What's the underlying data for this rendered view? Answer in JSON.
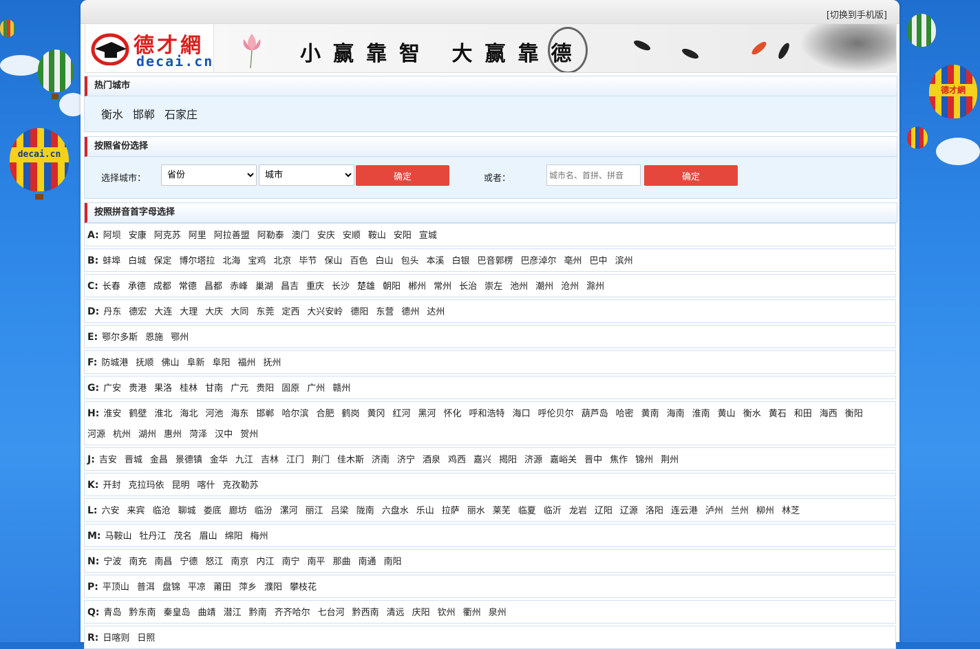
{
  "header": {
    "mobile_link": "[切换到手机版]",
    "logo_cn": "德才網",
    "logo_en": "decai.cn",
    "slogan": "小赢靠智 大赢靠德",
    "balloon_label": "decai.cn",
    "balloon_label_right": "德才網"
  },
  "hot": {
    "title": "热门城市",
    "cities": [
      "衡水",
      "邯郸",
      "石家庄"
    ]
  },
  "province": {
    "title": "按照省份选择",
    "label": "选择城市：",
    "province_select": "省份",
    "city_select": "城市",
    "confirm1": "确定",
    "or_label": "或者：",
    "search_placeholder": "城市名、首拼、拼音",
    "confirm2": "确定"
  },
  "pinyin": {
    "title": "按照拼音首字母选择",
    "rows": [
      {
        "letter": "A:",
        "cities": [
          "阿坝",
          "安康",
          "阿克苏",
          "阿里",
          "阿拉善盟",
          "阿勒泰",
          "澳门",
          "安庆",
          "安顺",
          "鞍山",
          "安阳",
          "宣城"
        ]
      },
      {
        "letter": "B:",
        "cities": [
          "蚌埠",
          "白城",
          "保定",
          "博尔塔拉",
          "北海",
          "宝鸡",
          "北京",
          "毕节",
          "保山",
          "百色",
          "白山",
          "包头",
          "本溪",
          "白银",
          "巴音郭楞",
          "巴彦淖尔",
          "亳州",
          "巴中",
          "滨州"
        ]
      },
      {
        "letter": "C:",
        "cities": [
          "长春",
          "承德",
          "成都",
          "常德",
          "昌都",
          "赤峰",
          "巢湖",
          "昌吉",
          "重庆",
          "长沙",
          "楚雄",
          "朝阳",
          "郴州",
          "常州",
          "长治",
          "崇左",
          "池州",
          "潮州",
          "沧州",
          "滁州"
        ]
      },
      {
        "letter": "D:",
        "cities": [
          "丹东",
          "德宏",
          "大连",
          "大理",
          "大庆",
          "大同",
          "东莞",
          "定西",
          "大兴安岭",
          "德阳",
          "东营",
          "德州",
          "达州"
        ]
      },
      {
        "letter": "E:",
        "cities": [
          "鄂尔多斯",
          "恩施",
          "鄂州"
        ]
      },
      {
        "letter": "F:",
        "cities": [
          "防城港",
          "抚顺",
          "佛山",
          "阜新",
          "阜阳",
          "福州",
          "抚州"
        ]
      },
      {
        "letter": "G:",
        "cities": [
          "广安",
          "贵港",
          "果洛",
          "桂林",
          "甘南",
          "广元",
          "贵阳",
          "固原",
          "广州",
          "赣州"
        ]
      },
      {
        "letter": "H:",
        "cities": [
          "淮安",
          "鹤壁",
          "淮北",
          "海北",
          "河池",
          "海东",
          "邯郸",
          "哈尔滨",
          "合肥",
          "鹤岗",
          "黄冈",
          "红河",
          "黑河",
          "怀化",
          "呼和浩特",
          "海口",
          "呼伦贝尔",
          "葫芦岛",
          "哈密",
          "黄南",
          "海南",
          "淮南",
          "黄山",
          "衡水",
          "黄石",
          "和田",
          "海西",
          "衡阳",
          "河源",
          "杭州",
          "湖州",
          "惠州",
          "菏泽",
          "汉中",
          "贺州"
        ]
      },
      {
        "letter": "J:",
        "cities": [
          "吉安",
          "晋城",
          "金昌",
          "景德镇",
          "金华",
          "九江",
          "吉林",
          "江门",
          "荆门",
          "佳木斯",
          "济南",
          "济宁",
          "酒泉",
          "鸡西",
          "嘉兴",
          "揭阳",
          "济源",
          "嘉峪关",
          "晋中",
          "焦作",
          "锦州",
          "荆州"
        ]
      },
      {
        "letter": "K:",
        "cities": [
          "开封",
          "克拉玛依",
          "昆明",
          "喀什",
          "克孜勒苏"
        ]
      },
      {
        "letter": "L:",
        "cities": [
          "六安",
          "来宾",
          "临沧",
          "聊城",
          "娄底",
          "廊坊",
          "临汾",
          "漯河",
          "丽江",
          "吕梁",
          "陇南",
          "六盘水",
          "乐山",
          "拉萨",
          "丽水",
          "莱芜",
          "临夏",
          "临沂",
          "龙岩",
          "辽阳",
          "辽源",
          "洛阳",
          "连云港",
          "泸州",
          "兰州",
          "柳州",
          "林芝"
        ]
      },
      {
        "letter": "M:",
        "cities": [
          "马鞍山",
          "牡丹江",
          "茂名",
          "眉山",
          "绵阳",
          "梅州"
        ]
      },
      {
        "letter": "N:",
        "cities": [
          "宁波",
          "南充",
          "南昌",
          "宁德",
          "怒江",
          "南京",
          "内江",
          "南宁",
          "南平",
          "那曲",
          "南通",
          "南阳"
        ]
      },
      {
        "letter": "P:",
        "cities": [
          "平顶山",
          "普洱",
          "盘锦",
          "平凉",
          "莆田",
          "萍乡",
          "濮阳",
          "攀枝花"
        ]
      },
      {
        "letter": "Q:",
        "cities": [
          "青岛",
          "黔东南",
          "秦皇岛",
          "曲靖",
          "潜江",
          "黔南",
          "齐齐哈尔",
          "七台河",
          "黔西南",
          "清远",
          "庆阳",
          "钦州",
          "衢州",
          "泉州"
        ]
      },
      {
        "letter": "R:",
        "cities": [
          "日喀则",
          "日照"
        ]
      }
    ]
  }
}
